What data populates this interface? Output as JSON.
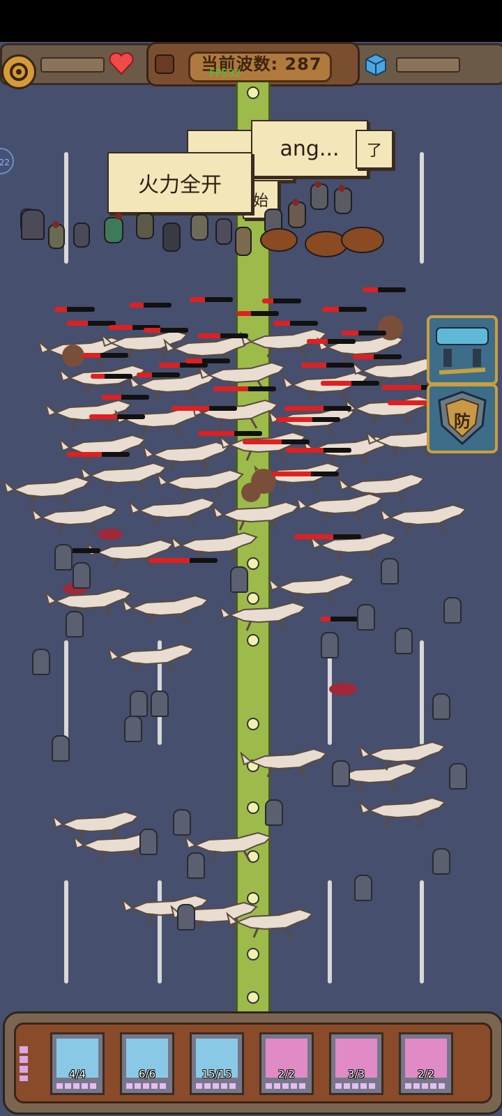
{
  "hud": {
    "wave_label": "当前波数: 287",
    "fps": "FPS32",
    "side_badge": "22",
    "icons": [
      "gear-icon",
      "heart-icon",
      "cube-icon"
    ]
  },
  "speech_bubbles": [
    {
      "text": "火力全开"
    },
    {
      "text": "ang..."
    },
    {
      "text": "了"
    },
    {
      "text": "始"
    }
  ],
  "skills": [
    {
      "name": "weapon-skill"
    },
    {
      "name": "defense-skill",
      "label": "防"
    }
  ],
  "units": [
    {
      "name": "pistol-soldier",
      "count": "4/4",
      "color": "#8ac9e6"
    },
    {
      "name": "cavalry",
      "count": "6/6",
      "color": "#8ac9e6"
    },
    {
      "name": "white-knight",
      "count": "15/15",
      "color": "#8ac9e6"
    },
    {
      "name": "yellow-robe",
      "count": "2/2",
      "color": "#e08ac6"
    },
    {
      "name": "alchemist",
      "count": "3/3",
      "color": "#e08ac6"
    },
    {
      "name": "rifleman",
      "count": "2/2",
      "color": "#e08ac6"
    }
  ],
  "colors": {
    "background": "#474f6e",
    "road": "#9cbb4a",
    "wolf": "#e8ddd0",
    "hp": "#e02020"
  }
}
